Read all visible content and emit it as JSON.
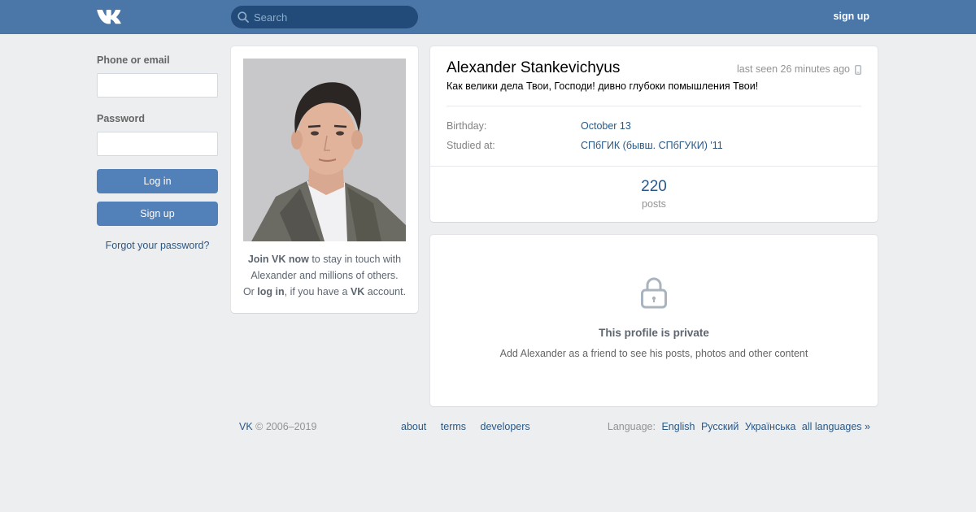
{
  "header": {
    "search_placeholder": "Search",
    "signup_label": "sign up",
    "logo_icon": "vk-logo-icon",
    "search_icon": "search-icon"
  },
  "login": {
    "phone_label": "Phone or email",
    "phone_value": "",
    "password_label": "Password",
    "password_value": "",
    "login_button": "Log in",
    "signup_button": "Sign up",
    "forgot_link": "Forgot your password?"
  },
  "photo_card": {
    "join_strong": "Join VK now",
    "join_rest": " to stay in touch with Alexander and millions of others.",
    "or_text": "Or ",
    "login_strong": "log in",
    "if_text": ", if you have a ",
    "vk_strong": "VK",
    "account_text": " account."
  },
  "profile": {
    "name": "Alexander Stankevichyus",
    "last_seen": "last seen 26 minutes ago",
    "status": "Как велики дела Твои, Господи! дивно глубоки помышления Твои!",
    "rows": [
      {
        "label": "Birthday:",
        "value": "October 13"
      },
      {
        "label": "Studied at:",
        "value": "СПбГИК (бывш. СПбГУКИ) '11"
      }
    ],
    "posts_count": "220",
    "posts_label": "posts"
  },
  "private": {
    "title": "This profile is private",
    "text": "Add Alexander as a friend to see his posts, photos and other content",
    "icon": "lock-icon"
  },
  "footer": {
    "vk": "VK",
    "copyright": " © 2006–2019",
    "links": [
      "about",
      "terms",
      "developers"
    ],
    "language_label": "Language:",
    "languages": [
      "English",
      "Русский",
      "Українська",
      "all languages »"
    ]
  },
  "colors": {
    "header": "#4a76a8",
    "search_bg": "#224b7a",
    "button": "#5181b8",
    "link": "#2a5885",
    "page_bg": "#edeef0"
  }
}
